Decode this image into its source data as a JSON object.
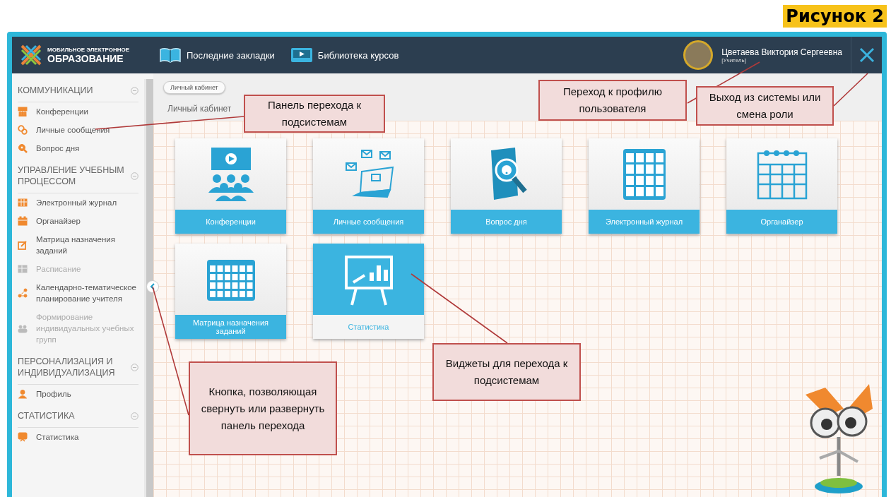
{
  "figure_label": "Рисунок 2",
  "header": {
    "logo": {
      "top_line": "МОБИЛЬНОЕ ЭЛЕКТРОННОЕ",
      "bottom_line": "ОБРАЗОВАНИЕ"
    },
    "nav": [
      {
        "label": "Последние закладки"
      },
      {
        "label": "Библиотека курсов"
      }
    ],
    "user": {
      "name": "Цветаева Виктория Сергеевна",
      "role": "[Учитель]"
    }
  },
  "sidebar": {
    "sections": [
      {
        "title": "КОММУНИКАЦИИ",
        "expanded": true,
        "items": [
          {
            "label": "Конференции",
            "disabled": false
          },
          {
            "label": "Личные сообщения",
            "disabled": false
          },
          {
            "label": "Вопрос дня",
            "disabled": false
          }
        ]
      },
      {
        "title": "УПРАВЛЕНИЕ УЧЕБНЫМ ПРОЦЕССОМ",
        "expanded": true,
        "items": [
          {
            "label": "Электронный журнал",
            "disabled": false
          },
          {
            "label": "Органайзер",
            "disabled": false
          },
          {
            "label": "Матрица назначения заданий",
            "disabled": false
          },
          {
            "label": "Расписание",
            "disabled": true
          },
          {
            "label": "Календарно-тематическое планирование учителя",
            "disabled": false
          },
          {
            "label": "Формирование индивидуальных учебных групп",
            "disabled": true
          }
        ]
      },
      {
        "title": "ПЕРСОНАЛИЗАЦИЯ И ИНДИВИДУАЛИЗАЦИЯ",
        "expanded": true,
        "items": [
          {
            "label": "Профиль",
            "disabled": false
          }
        ]
      },
      {
        "title": "СТАТИСТИКА",
        "expanded": true,
        "items": [
          {
            "label": "Статистика",
            "disabled": false
          }
        ]
      }
    ]
  },
  "breadcrumb": "Личный кабинет",
  "page_title": "Личный кабинет",
  "widgets": [
    {
      "label": "Конференции",
      "selected": false
    },
    {
      "label": "Личные сообщения",
      "selected": false
    },
    {
      "label": "Вопрос дня",
      "selected": false
    },
    {
      "label": "Электронный журнал",
      "selected": false
    },
    {
      "label": "Органайзер",
      "selected": false
    },
    {
      "label": "Матрица назначения заданий",
      "selected": false
    },
    {
      "label": "Статистика",
      "selected": true
    }
  ],
  "callouts": [
    {
      "text": "Панель перехода к подсистемам"
    },
    {
      "text": "Переход к профилю пользователя"
    },
    {
      "text": "Выход из системы или смена роли"
    },
    {
      "text": "Кнопка, позволяющая свернуть или развернуть панель перехода"
    },
    {
      "text": "Виджеты для перехода к подсистемам"
    }
  ]
}
